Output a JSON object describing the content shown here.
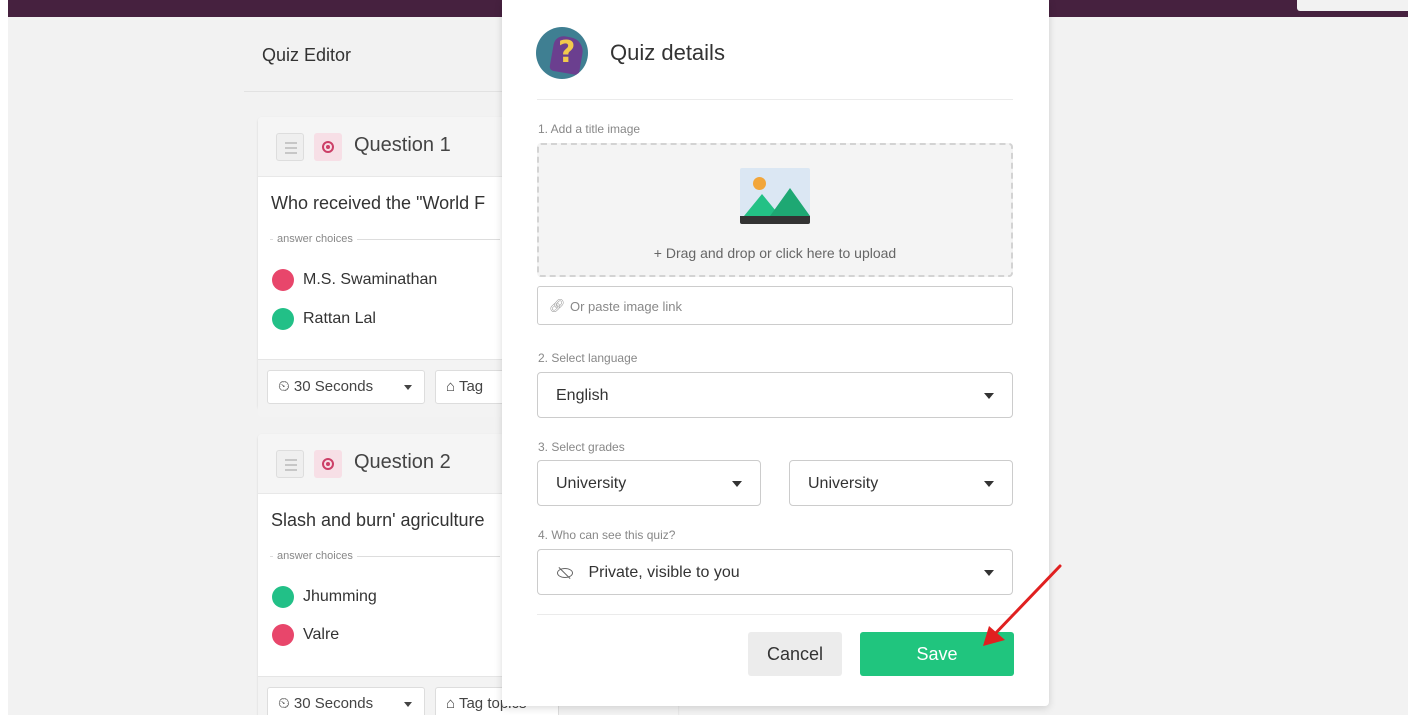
{
  "editor": {
    "title": "Quiz Editor",
    "answer_choices_label": "answer choices",
    "questions": [
      {
        "label": "Question 1",
        "text": "Who received the \"World F",
        "choices": [
          {
            "text": "M.S. Swaminathan",
            "color": "#e8466b"
          },
          {
            "text": "Rattan Lal",
            "color": "#22c087"
          }
        ],
        "time": "30 Seconds",
        "tag": "Tag"
      },
      {
        "label": "Question 2",
        "text": "Slash and burn' agriculture",
        "choices": [
          {
            "text": "Jhumming",
            "color": "#22c087"
          },
          {
            "text": "Valre",
            "color": "#e8466b"
          }
        ],
        "time": "30 Seconds",
        "tag": "Tag topics"
      }
    ]
  },
  "modal": {
    "title": "Quiz details",
    "step1_label": "1. Add a title image",
    "upload_text": "+ Drag and drop or click here to upload",
    "image_link_placeholder": "Or paste image link",
    "step2_label": "2. Select language",
    "language": "English",
    "step3_label": "3. Select grades",
    "grade_from": "University",
    "grade_to": "University",
    "step4_label": "4. Who can see this quiz?",
    "visibility": "Private, visible to you",
    "cancel_label": "Cancel",
    "save_label": "Save"
  },
  "colors": {
    "topbar": "#46213f",
    "save": "#20c57e",
    "arrow": "#e02020"
  },
  "icons": {
    "quiz_logo": "quiz-logo-icon",
    "upload": "image-placeholder-icon",
    "link": "link-icon",
    "visibility": "eye-slash-icon",
    "time": "clock-icon",
    "tag": "tag-icon",
    "question_type": "radio-target-icon",
    "drag": "drag-handle-icon"
  }
}
